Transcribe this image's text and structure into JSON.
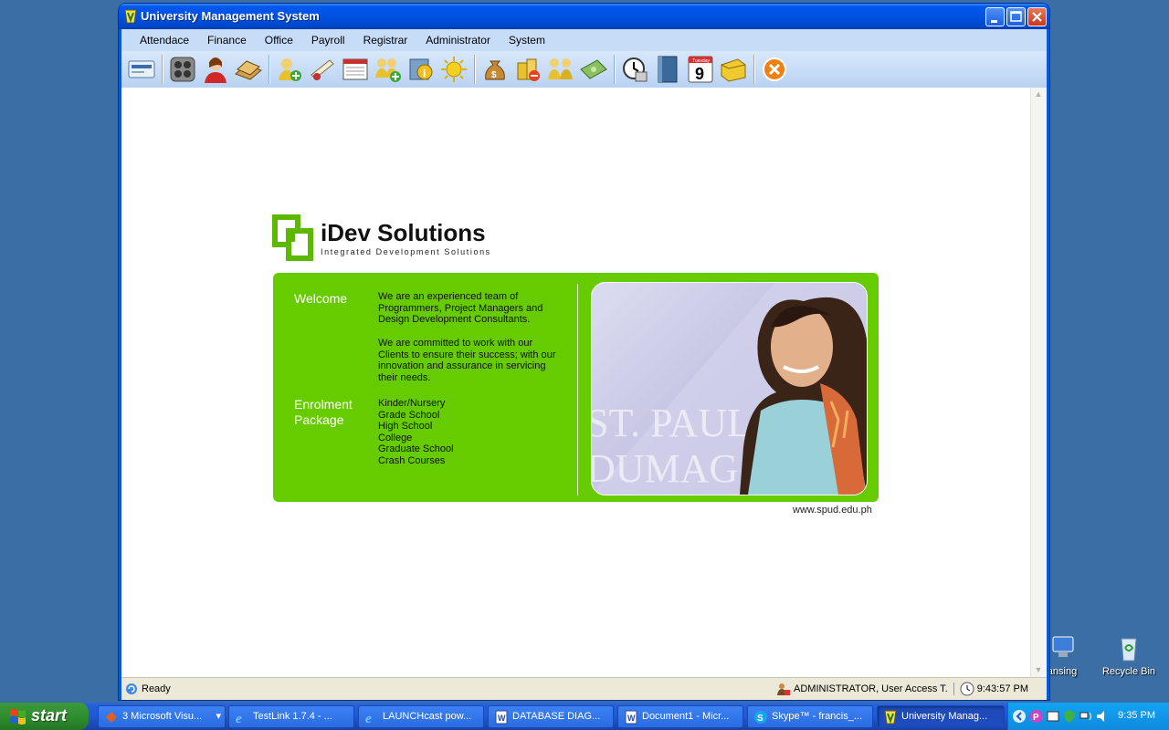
{
  "window": {
    "title": "University Management System"
  },
  "menu": [
    "Attendace",
    "Finance",
    "Office",
    "Payroll",
    "Registrar",
    "Administrator",
    "System"
  ],
  "toolbar_icons": [
    "id-card-icon",
    "calculator-icon",
    "user-icon",
    "books-icon",
    "add-user-icon",
    "diploma-icon",
    "window-icon",
    "add-group-icon",
    "info-icon",
    "sun-icon",
    "money-bag-icon",
    "coins-icon",
    "group-icon",
    "cash-icon",
    "clock-icon",
    "book-icon",
    "calendar-icon",
    "folder-icon",
    "exit-icon"
  ],
  "calendar_icon": {
    "day": "Tuesday",
    "date": "9"
  },
  "logo": {
    "name": "iDev Solutions",
    "tagline": "Integrated Development Solutions"
  },
  "panel": {
    "welcome_label": "Welcome",
    "welcome_p1": [
      "We are an experienced team of",
      "Programmers, Project Managers and",
      "Design Development Consultants."
    ],
    "welcome_p2": [
      "We are committed to work with our",
      "Clients to ensure their success; with our",
      "innovation and assurance in servicing",
      "their needs."
    ],
    "enrolment_label": [
      "Enrolment",
      "Package"
    ],
    "packages": [
      "Kinder/Nursery",
      "Grade School",
      "High School",
      "College",
      "Graduate School",
      "Crash Courses"
    ],
    "photo_text": [
      "ST. PAUL",
      "DUMAG"
    ]
  },
  "website": "www.spud.edu.ph",
  "status": {
    "left": "Ready",
    "user": "ADMINISTRATOR, User Access T.",
    "time": "9:43:57 PM"
  },
  "desktop_icons": [
    {
      "label": "ansing"
    },
    {
      "label": "Recycle Bin"
    }
  ],
  "taskbar": {
    "start": "start",
    "tasks": [
      {
        "label": "3 Microsoft Visu...",
        "active": false
      },
      {
        "label": "TestLink 1.7.4 - ...",
        "active": false
      },
      {
        "label": "LAUNCHcast pow...",
        "active": false
      },
      {
        "label": "DATABASE DIAG...",
        "active": false
      },
      {
        "label": "Document1 - Micr...",
        "active": false
      },
      {
        "label": "Skype™ - francis_...",
        "active": false
      },
      {
        "label": "University Manag...",
        "active": true
      }
    ],
    "clock": "9:35 PM"
  },
  "colors": {
    "panel_green": "#66cc00",
    "xp_blue": "#0058ee",
    "menubar": "#c6dcf7"
  }
}
